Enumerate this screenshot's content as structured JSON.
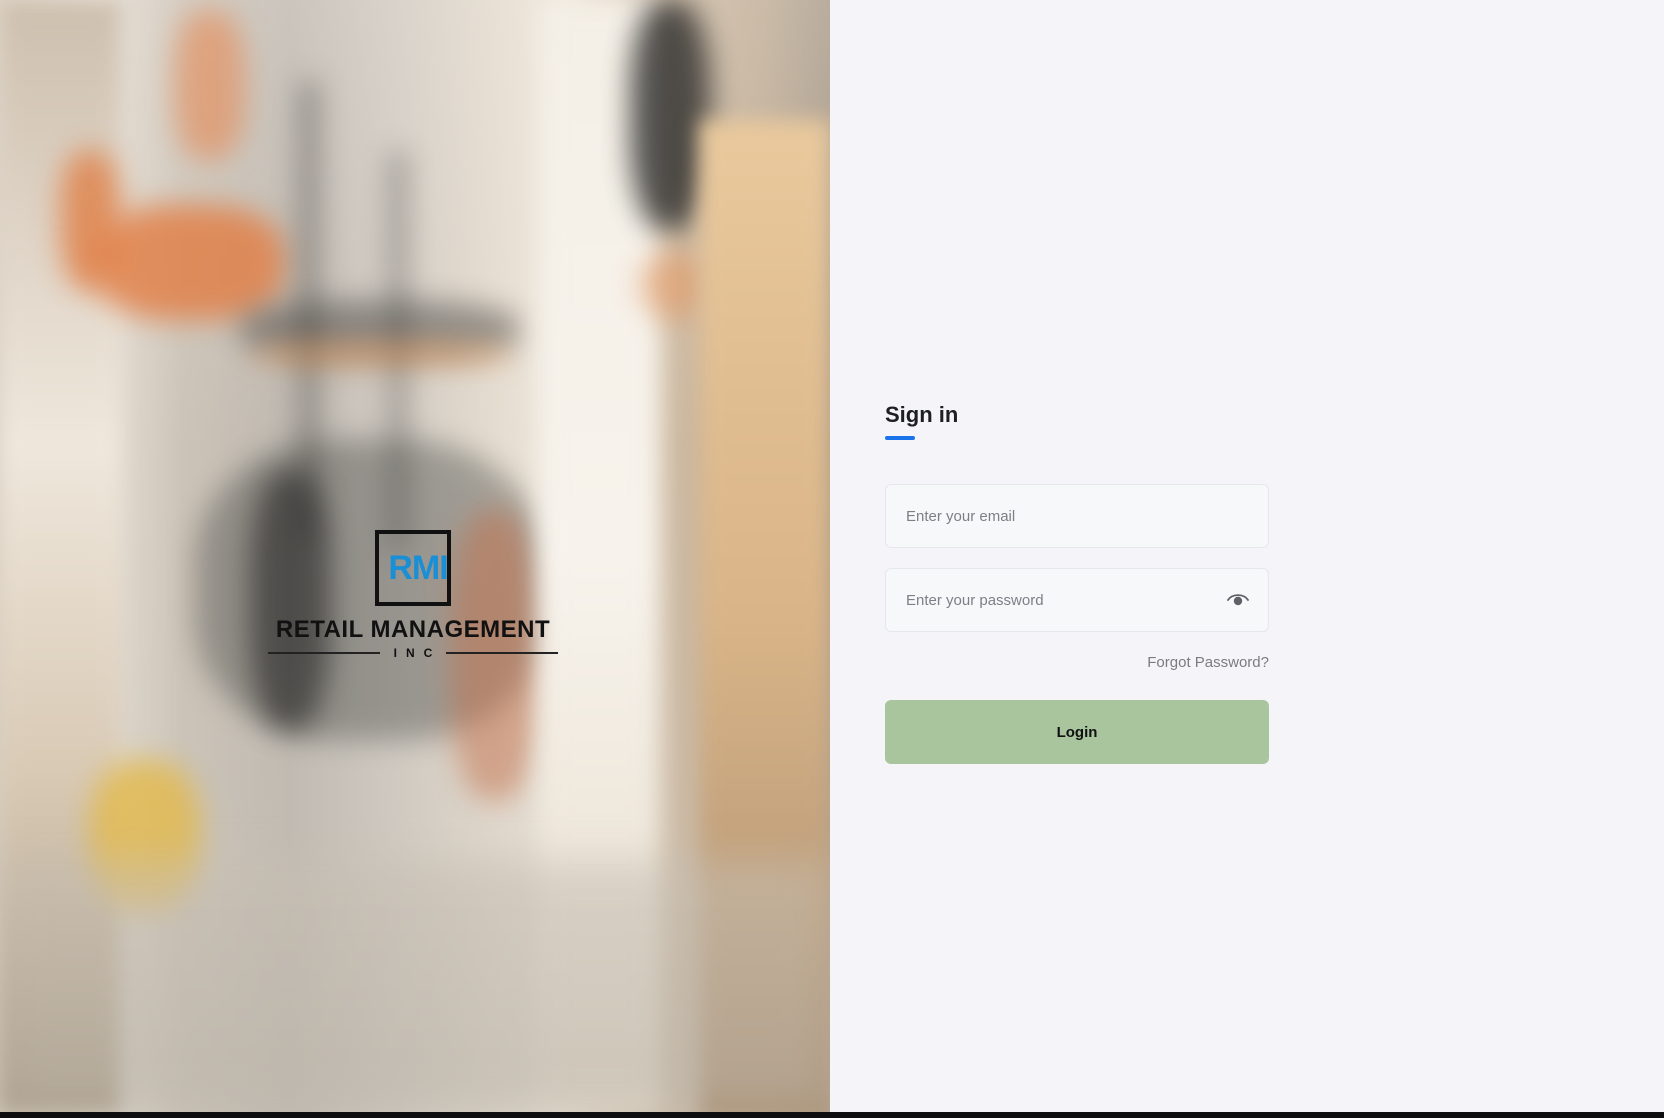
{
  "brand": {
    "logo_mark": "RMI",
    "name": "RETAIL MANAGEMENT",
    "sub": "INC"
  },
  "form": {
    "title": "Sign in",
    "accent_color": "#1a73e8",
    "email": {
      "placeholder": "Enter your email",
      "value": ""
    },
    "password": {
      "placeholder": "Enter your password",
      "value": "",
      "toggle_icon": "eye-icon"
    },
    "forgot_label": "Forgot Password?",
    "login_label": "Login",
    "login_color": "#a8c59e"
  }
}
